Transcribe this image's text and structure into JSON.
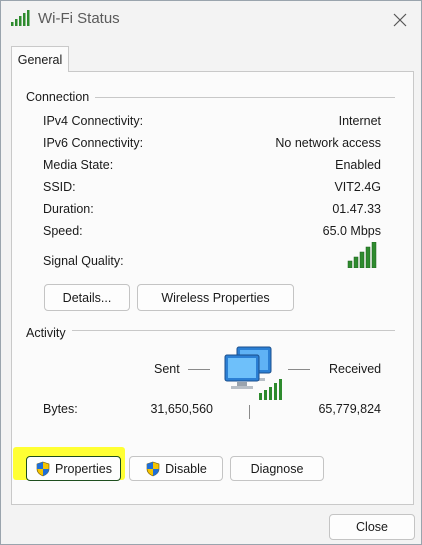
{
  "window": {
    "title": "Wi-Fi Status",
    "close_glyph": "✕",
    "title_icon": "wifi-signal-icon"
  },
  "tabs": [
    {
      "label": "General",
      "selected": true
    }
  ],
  "connection": {
    "heading": "Connection",
    "rows": [
      {
        "label": "IPv4 Connectivity:",
        "value": "Internet"
      },
      {
        "label": "IPv6 Connectivity:",
        "value": "No network access"
      },
      {
        "label": "Media State:",
        "value": "Enabled"
      },
      {
        "label": "SSID:",
        "value": "VIT2.4G"
      },
      {
        "label": "Duration:",
        "value": "01.47.33"
      },
      {
        "label": "Speed:",
        "value": "65.0 Mbps"
      }
    ],
    "signal_quality_label": "Signal Quality:",
    "signal_quality_bars": 5,
    "details_button": "Details...",
    "wireless_properties_button": "Wireless Properties"
  },
  "activity": {
    "heading": "Activity",
    "sent_label": "Sent",
    "received_label": "Received",
    "bytes_label": "Bytes:",
    "bytes_sent": "31,650,560",
    "bytes_received": "65,779,824",
    "properties_button": "Properties",
    "disable_button": "Disable",
    "diagnose_button": "Diagnose"
  },
  "footer": {
    "close_button": "Close"
  },
  "colors": {
    "signal_green": "#2e8b2e",
    "highlight": "#ffff33",
    "shield_blue": "#1f6fd6",
    "shield_yellow": "#f5c400"
  }
}
